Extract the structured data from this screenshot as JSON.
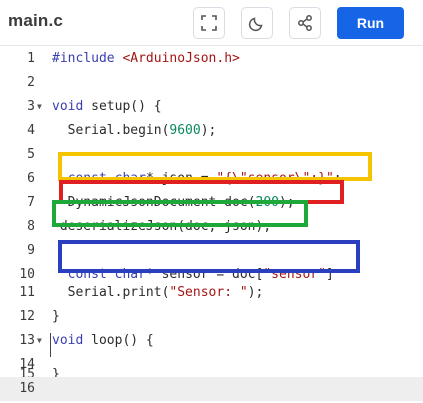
{
  "header": {
    "file_name": "main.c",
    "run_label": "Run",
    "icons": [
      "fullscreen-icon",
      "dark-mode-moon-icon",
      "share-icon"
    ]
  },
  "editor": {
    "lines": [
      {
        "n": "1",
        "fold": false
      },
      {
        "n": "2",
        "fold": false
      },
      {
        "n": "3",
        "fold": true
      },
      {
        "n": "4",
        "fold": false
      },
      {
        "n": "5",
        "fold": false
      },
      {
        "n": "6",
        "fold": false
      },
      {
        "n": "7",
        "fold": false
      },
      {
        "n": "8",
        "fold": false
      },
      {
        "n": "9",
        "fold": false
      },
      {
        "n": "10",
        "fold": false
      },
      {
        "n": "11",
        "fold": false
      },
      {
        "n": "12",
        "fold": false
      },
      {
        "n": "13",
        "fold": true
      },
      {
        "n": "14",
        "fold": false
      },
      {
        "n": "15",
        "fold": false
      },
      {
        "n": "16",
        "fold": false
      }
    ],
    "code": {
      "l1_kw": "#include ",
      "l1_inc": "<ArduinoJson.h>",
      "l3_kw": "void",
      "l3_rest": " setup() {",
      "l4_a": "  Serial.begin(",
      "l4_num": "9600",
      "l4_b": ");",
      "l6_pad": "  ",
      "l6_kw1": "const",
      "l6_sp": " ",
      "l6_kw2": "char",
      "l6_mid": "* json = ",
      "l6_str": "\"{\\\"sensor\\\":}\"",
      "l6_end": ";",
      "l7_a": "  DynamicJsonDocument doc(",
      "l7_num": "200",
      "l7_b": ");",
      "l8": " deserializeJson(doc, json);",
      "l10_pad": "  ",
      "l10_kw1": "const",
      "l10_sp": " ",
      "l10_kw2": "char",
      "l10_mid": "* sensor = doc[",
      "l10_str": "\"sensor\"",
      "l10_end": "]",
      "l11_a": "  Serial.print(",
      "l11_str": "\"Sensor: \"",
      "l11_b": ");",
      "l12": "}",
      "l13_kw": "void",
      "l13_rest": " loop() {",
      "l15": "}"
    },
    "active_line": "16"
  },
  "annotations": {
    "colors": {
      "yellow": "#f5c400",
      "red": "#e02020",
      "green": "#1fa83a",
      "blue": "#2a3fbf"
    }
  },
  "theme": {
    "run_color": "#1565e6"
  }
}
